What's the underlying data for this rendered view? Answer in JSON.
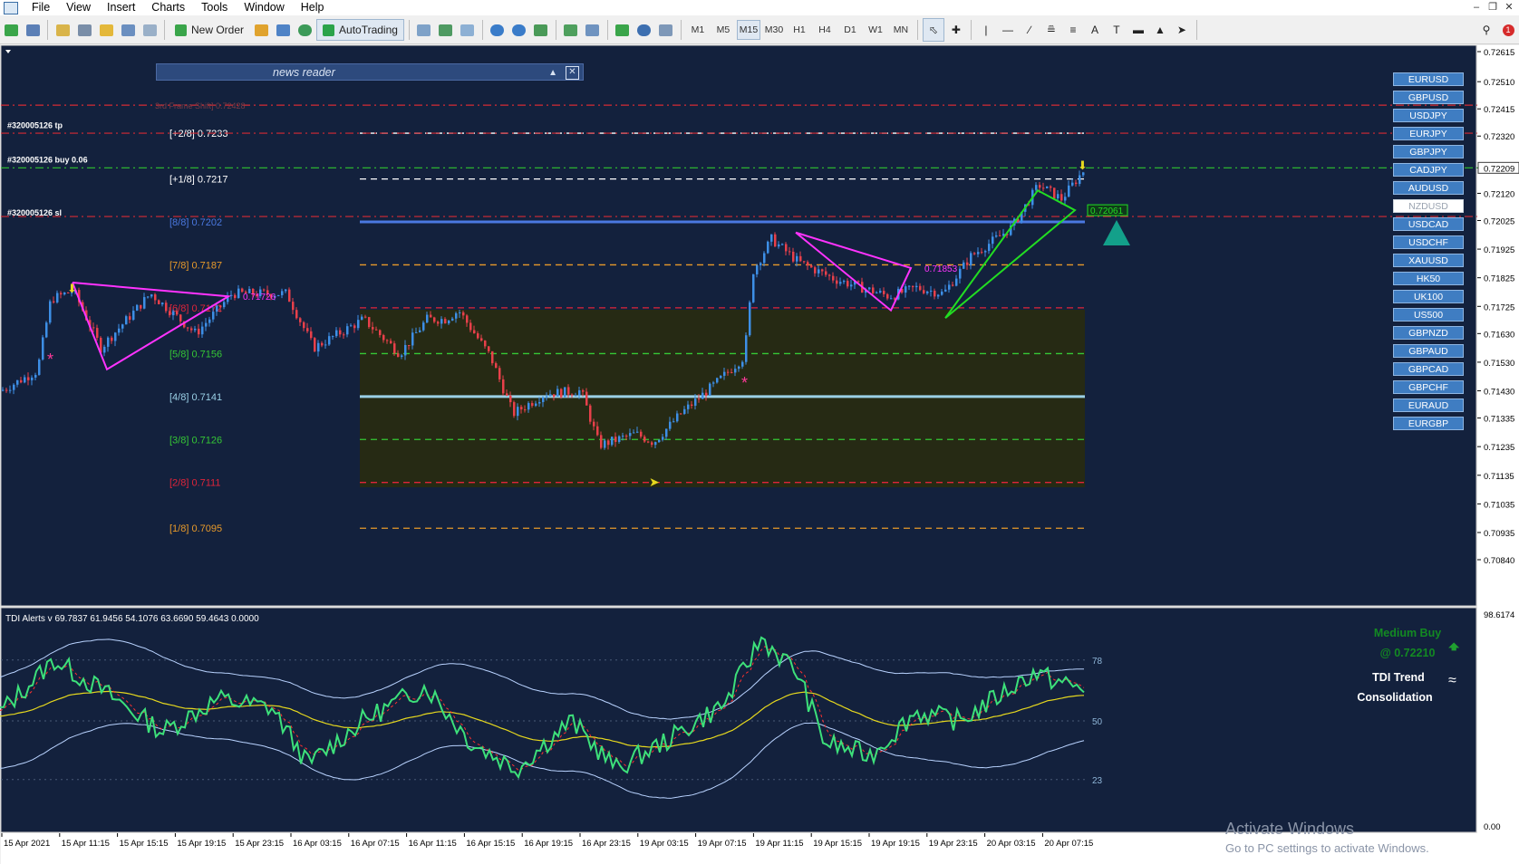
{
  "menu": [
    "File",
    "View",
    "Insert",
    "Charts",
    "Tools",
    "Window",
    "Help"
  ],
  "toolbar": {
    "new_order": "New Order",
    "autotrading": "AutoTrading",
    "timeframes": [
      "M1",
      "M5",
      "M15",
      "M30",
      "H1",
      "H4",
      "D1",
      "W1",
      "MN"
    ],
    "active_timeframe": "M15"
  },
  "news_reader": {
    "title": "news reader"
  },
  "price_axis": [
    "0.72615",
    "0.72510",
    "0.72415",
    "0.72320",
    "0.72209",
    "0.72120",
    "0.72025",
    "0.71925",
    "0.71825",
    "0.71725",
    "0.71630",
    "0.71530",
    "0.71430",
    "0.71335",
    "0.71235",
    "0.71135",
    "0.71035",
    "0.70935",
    "0.70840"
  ],
  "current_price": "0.72209",
  "trade_labels": {
    "tp": "#320005126 tp",
    "buy": "#320005126 buy 0.06",
    "sl": "#320005126 sl"
  },
  "frame_shift": "3rd Frame Shift] 0.72428",
  "murrey_levels": [
    {
      "label": "[+2/8]",
      "price": "0.7233",
      "color": "#ffffff"
    },
    {
      "label": "[+1/8]",
      "price": "0.7217",
      "color": "#ffffff"
    },
    {
      "label": "[8/8]",
      "price": "0.7202",
      "color": "#4a78e0"
    },
    {
      "label": "[7/8]",
      "price": "0.7187",
      "color": "#e89a2a"
    },
    {
      "label": "[6/8]",
      "price": "0.7172",
      "color": "#e0243a"
    },
    {
      "label": "[5/8]",
      "price": "0.7156",
      "color": "#35c835"
    },
    {
      "label": "[4/8]",
      "price": "0.7141",
      "color": "#9ad0e6"
    },
    {
      "label": "[3/8]",
      "price": "0.7126",
      "color": "#35c835"
    },
    {
      "label": "[2/8]",
      "price": "0.7111",
      "color": "#e0243a"
    },
    {
      "label": "[1/8]",
      "price": "0.7095",
      "color": "#e89a2a"
    }
  ],
  "pattern_labels": {
    "left": "0.71726",
    "mid": "0.71853",
    "right": "0.72061"
  },
  "symbols": [
    "EURUSD",
    "GBPUSD",
    "USDJPY",
    "EURJPY",
    "GBPJPY",
    "CADJPY",
    "AUDUSD",
    "NZDUSD",
    "USDCAD",
    "USDCHF",
    "XAUUSD",
    "HK50",
    "UK100",
    "US500",
    "GBPNZD",
    "GBPAUD",
    "GBPCAD",
    "GBPCHF",
    "EURAUD",
    "EURGBP"
  ],
  "selected_symbol": "NZDUSD",
  "tdi": {
    "header": "TDI Alerts v 69.7837 61.9456 54.1076 63.6690 59.4643 0.0000",
    "levels": [
      "78",
      "50",
      "23"
    ],
    "axis_top": "98.6174",
    "axis_bottom": "0.00",
    "signal": "Medium Buy",
    "signal_price": "@ 0.72210",
    "trend_title": "TDI Trend",
    "trend_state": "Consolidation",
    "colors": {
      "rsi": "#3de07a",
      "signal": "#ff3030",
      "baseline": "#e6d81e",
      "bands": "#b9d3ff"
    }
  },
  "time_axis": [
    "15 Apr 2021",
    "15 Apr 11:15",
    "15 Apr 15:15",
    "15 Apr 19:15",
    "15 Apr 23:15",
    "16 Apr 03:15",
    "16 Apr 07:15",
    "16 Apr 11:15",
    "16 Apr 15:15",
    "16 Apr 19:15",
    "16 Apr 23:15",
    "19 Apr 03:15",
    "19 Apr 07:15",
    "19 Apr 11:15",
    "19 Apr 15:15",
    "19 Apr 19:15",
    "19 Apr 23:15",
    "20 Apr 03:15",
    "20 Apr 07:15"
  ],
  "watermark": {
    "line1": "Activate Windows",
    "line2": "Go to PC settings to activate Windows."
  },
  "colors": {
    "bg": "#13213d",
    "bull": "#3d8fe6",
    "bear": "#e8404a",
    "pattern_pink": "#ff33ff",
    "pattern_green": "#22dd22",
    "zone": "#262a14"
  }
}
